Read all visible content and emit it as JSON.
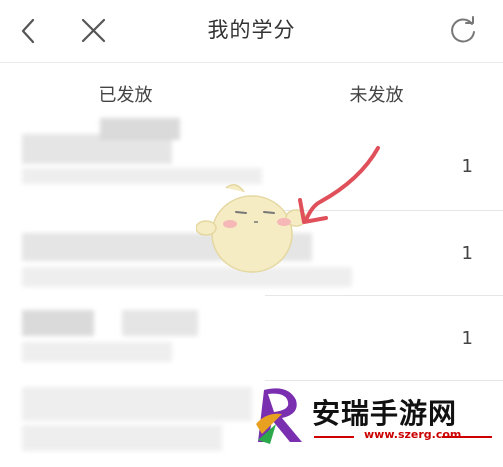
{
  "header": {
    "title": "我的学分",
    "back_icon": "chevron-left-icon",
    "close_icon": "close-icon",
    "refresh_icon": "refresh-icon"
  },
  "tabs": [
    {
      "label": "已发放"
    },
    {
      "label": "未发放"
    }
  ],
  "rows": [
    {
      "value": "1"
    },
    {
      "value": "1"
    },
    {
      "value": "1"
    }
  ],
  "watermark": {
    "text": "安瑞手游网",
    "url": "www.szerg.com"
  },
  "colors": {
    "arrow": "#e0505a",
    "watermark_accent": "#cc0000"
  }
}
